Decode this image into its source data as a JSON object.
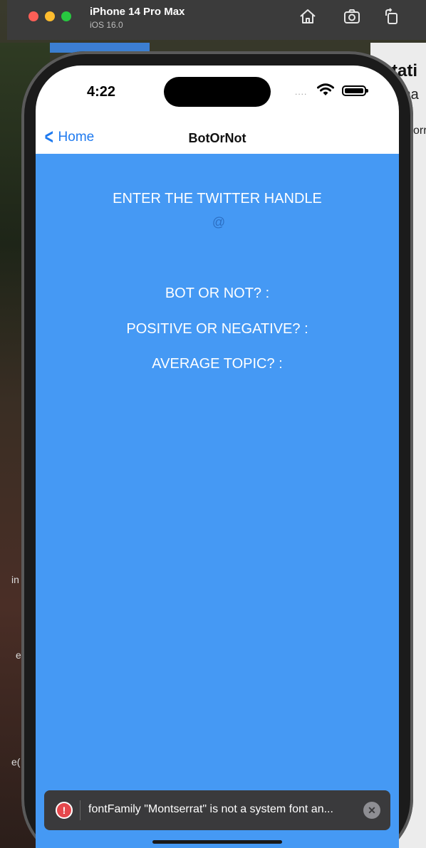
{
  "simulator": {
    "device_name": "iPhone 14 Pro Max",
    "os_version": "iOS 16.0",
    "home_icon": "home-icon",
    "screenshot_icon": "screenshot-icon",
    "rotate_icon": "rotate-icon"
  },
  "background": {
    "window_text_1": "tati",
    "window_text_2": "ma",
    "window_text_3": "orr",
    "side_text_1": "in",
    "side_text_2": "e",
    "side_text_3": "e("
  },
  "status_bar": {
    "time": "4:22",
    "signal": "....",
    "wifi_icon": "wifi-icon",
    "battery_icon": "battery-icon"
  },
  "navbar": {
    "back_label": "Home",
    "title": "BotOrNot"
  },
  "main": {
    "prompt": "ENTER THE TWITTER HANDLE",
    "handle_placeholder": "@",
    "bot_label": "BOT OR NOT? :",
    "sentiment_label": "POSITIVE OR NEGATIVE? :",
    "topic_label": "AVERAGE TOPIC? :"
  },
  "toast": {
    "message": "fontFamily \"Montserrat\" is not a system font an...",
    "error_icon": "!",
    "close_icon": "✕"
  },
  "colors": {
    "content_bg": "#4599f4",
    "accent": "#1f7aef",
    "error": "#e5484d"
  }
}
